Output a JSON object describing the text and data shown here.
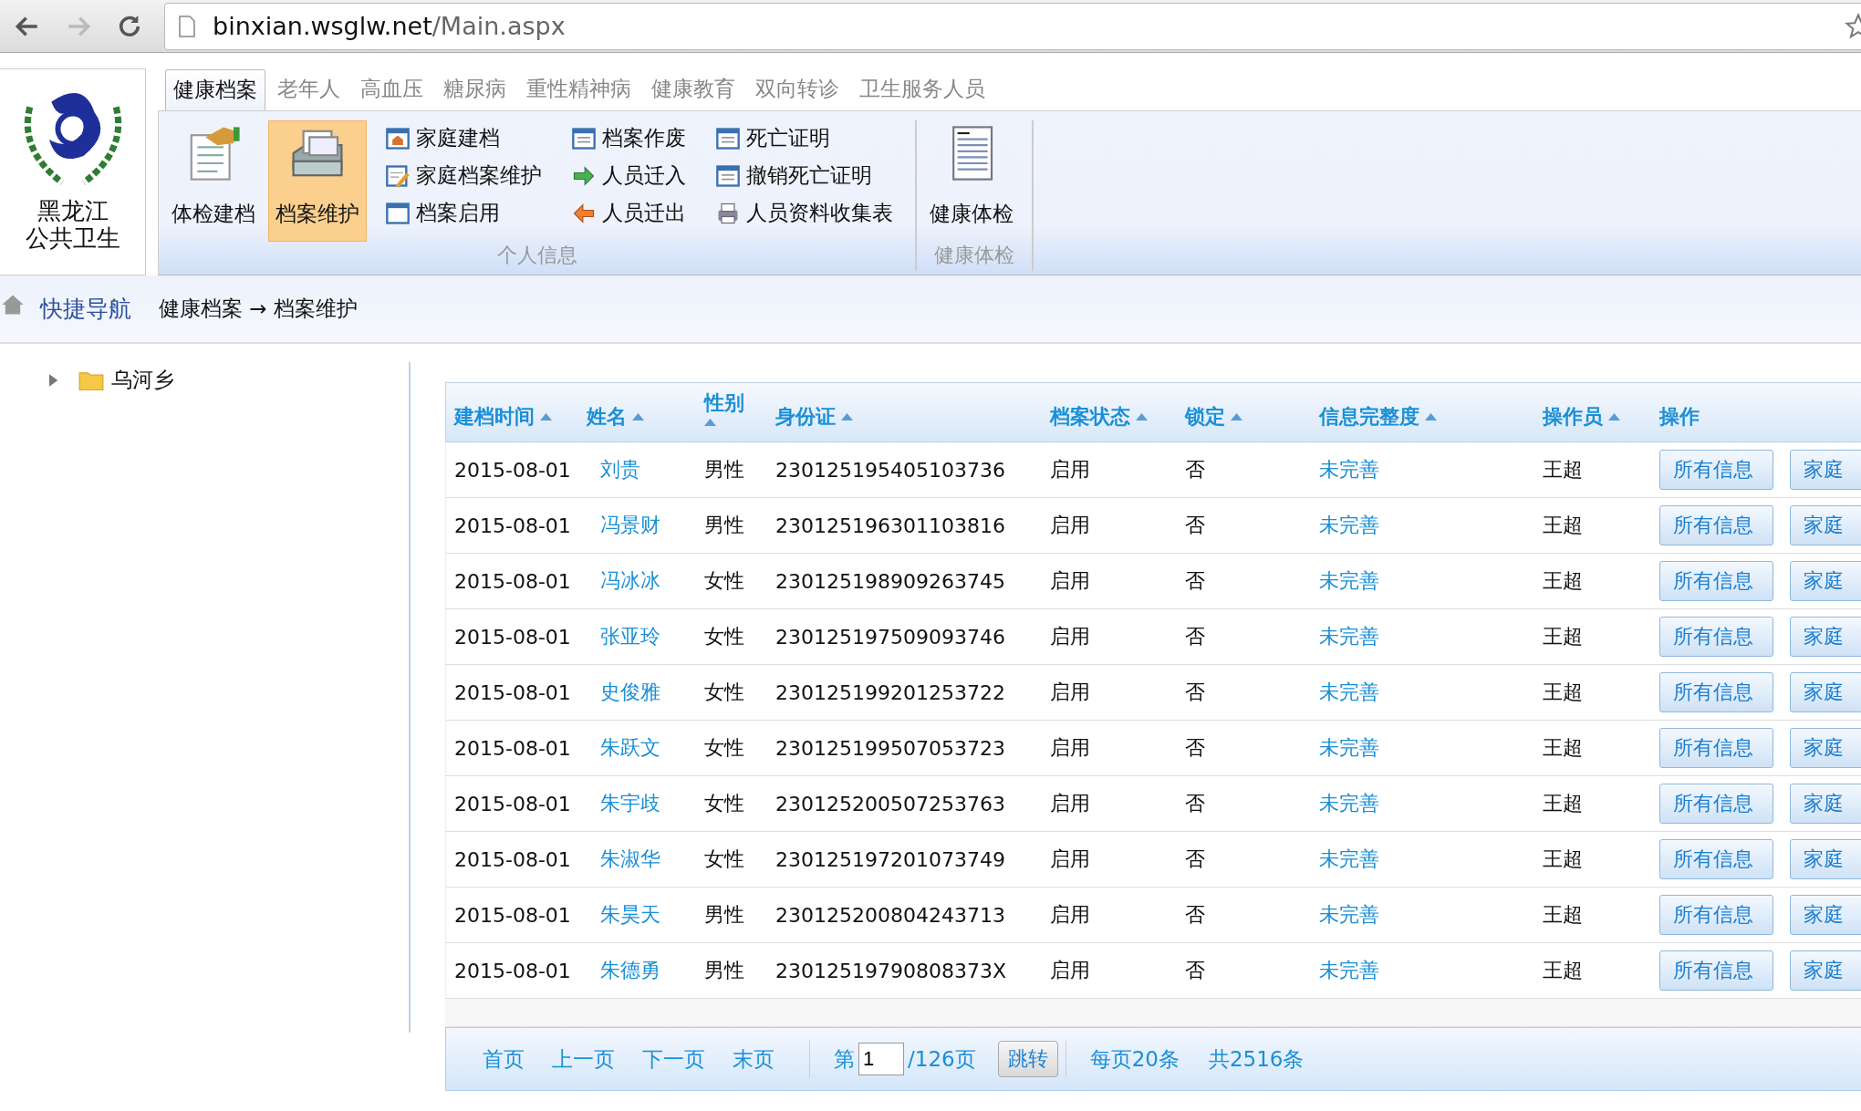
{
  "browser": {
    "url_host": "binxian.wsglw.net",
    "url_path": "/Main.aspx"
  },
  "logo": {
    "lines": [
      "黑龙江",
      "公共卫生"
    ]
  },
  "tabs": [
    {
      "label": "健康档案",
      "selected": true
    },
    {
      "label": "老年人",
      "selected": false
    },
    {
      "label": "高血压",
      "selected": false
    },
    {
      "label": "糖尿病",
      "selected": false
    },
    {
      "label": "重性精神病",
      "selected": false
    },
    {
      "label": "健康教育",
      "selected": false
    },
    {
      "label": "双向转诊",
      "selected": false
    },
    {
      "label": "卫生服务人员",
      "selected": false
    }
  ],
  "ribbon": {
    "groups": [
      {
        "title": "个人信息",
        "large_buttons": [
          {
            "label": "体检建档",
            "selected": false
          },
          {
            "label": "档案维护",
            "selected": true
          }
        ],
        "small_buttons": [
          "家庭建档",
          "家庭档案维护",
          "档案启用",
          "档案作废",
          "人员迁入",
          "人员迁出",
          "死亡证明",
          "撤销死亡证明",
          "人员资料收集表"
        ]
      },
      {
        "title": "健康体检",
        "large_buttons": [
          {
            "label": "健康体检",
            "selected": false
          }
        ]
      }
    ]
  },
  "nav": {
    "title": "快捷导航",
    "breadcrumb": "健康档案 → 档案维护"
  },
  "tree": [
    {
      "label": "乌河乡",
      "expanded": false
    }
  ],
  "table": {
    "columns": [
      {
        "label": "建档时间",
        "sortable": true
      },
      {
        "label": "姓名",
        "sortable": true
      },
      {
        "label": "性别",
        "sortable": true
      },
      {
        "label": "身份证",
        "sortable": true
      },
      {
        "label": "档案状态",
        "sortable": true
      },
      {
        "label": "锁定",
        "sortable": true
      },
      {
        "label": "信息完整度",
        "sortable": true
      },
      {
        "label": "操作员",
        "sortable": true
      },
      {
        "label": "操作",
        "sortable": false
      }
    ],
    "rows": [
      {
        "date": "2015-08-01",
        "name": "刘贵",
        "gender": "男性",
        "id": "230125195405103736",
        "status": "启用",
        "locked": "否",
        "completeness": "未完善",
        "operator": "王超",
        "actions": [
          "所有信息",
          "家庭"
        ]
      },
      {
        "date": "2015-08-01",
        "name": "冯景财",
        "gender": "男性",
        "id": "230125196301103816",
        "status": "启用",
        "locked": "否",
        "completeness": "未完善",
        "operator": "王超",
        "actions": [
          "所有信息",
          "家庭"
        ]
      },
      {
        "date": "2015-08-01",
        "name": "冯冰冰",
        "gender": "女性",
        "id": "230125198909263745",
        "status": "启用",
        "locked": "否",
        "completeness": "未完善",
        "operator": "王超",
        "actions": [
          "所有信息",
          "家庭"
        ]
      },
      {
        "date": "2015-08-01",
        "name": "张亚玲",
        "gender": "女性",
        "id": "230125197509093746",
        "status": "启用",
        "locked": "否",
        "completeness": "未完善",
        "operator": "王超",
        "actions": [
          "所有信息",
          "家庭"
        ]
      },
      {
        "date": "2015-08-01",
        "name": "史俊雅",
        "gender": "女性",
        "id": "230125199201253722",
        "status": "启用",
        "locked": "否",
        "completeness": "未完善",
        "operator": "王超",
        "actions": [
          "所有信息",
          "家庭"
        ]
      },
      {
        "date": "2015-08-01",
        "name": "朱跃文",
        "gender": "女性",
        "id": "230125199507053723",
        "status": "启用",
        "locked": "否",
        "completeness": "未完善",
        "operator": "王超",
        "actions": [
          "所有信息",
          "家庭"
        ]
      },
      {
        "date": "2015-08-01",
        "name": "朱宇歧",
        "gender": "女性",
        "id": "230125200507253763",
        "status": "启用",
        "locked": "否",
        "completeness": "未完善",
        "operator": "王超",
        "actions": [
          "所有信息",
          "家庭"
        ]
      },
      {
        "date": "2015-08-01",
        "name": "朱淑华",
        "gender": "女性",
        "id": "230125197201073749",
        "status": "启用",
        "locked": "否",
        "completeness": "未完善",
        "operator": "王超",
        "actions": [
          "所有信息",
          "家庭"
        ]
      },
      {
        "date": "2015-08-01",
        "name": "朱昊天",
        "gender": "男性",
        "id": "230125200804243713",
        "status": "启用",
        "locked": "否",
        "completeness": "未完善",
        "operator": "王超",
        "actions": [
          "所有信息",
          "家庭"
        ]
      },
      {
        "date": "2015-08-01",
        "name": "朱德勇",
        "gender": "男性",
        "id": "23012519790808373X",
        "status": "启用",
        "locked": "否",
        "completeness": "未完善",
        "operator": "王超",
        "actions": [
          "所有信息",
          "家庭"
        ]
      }
    ]
  },
  "pager": {
    "links": [
      "首页",
      "上一页",
      "下一页",
      "末页"
    ],
    "page_prefix": "第",
    "page_value": "1",
    "page_total": "/126页",
    "go": "跳转",
    "per_page": "每页20条",
    "total": "共2516条"
  }
}
